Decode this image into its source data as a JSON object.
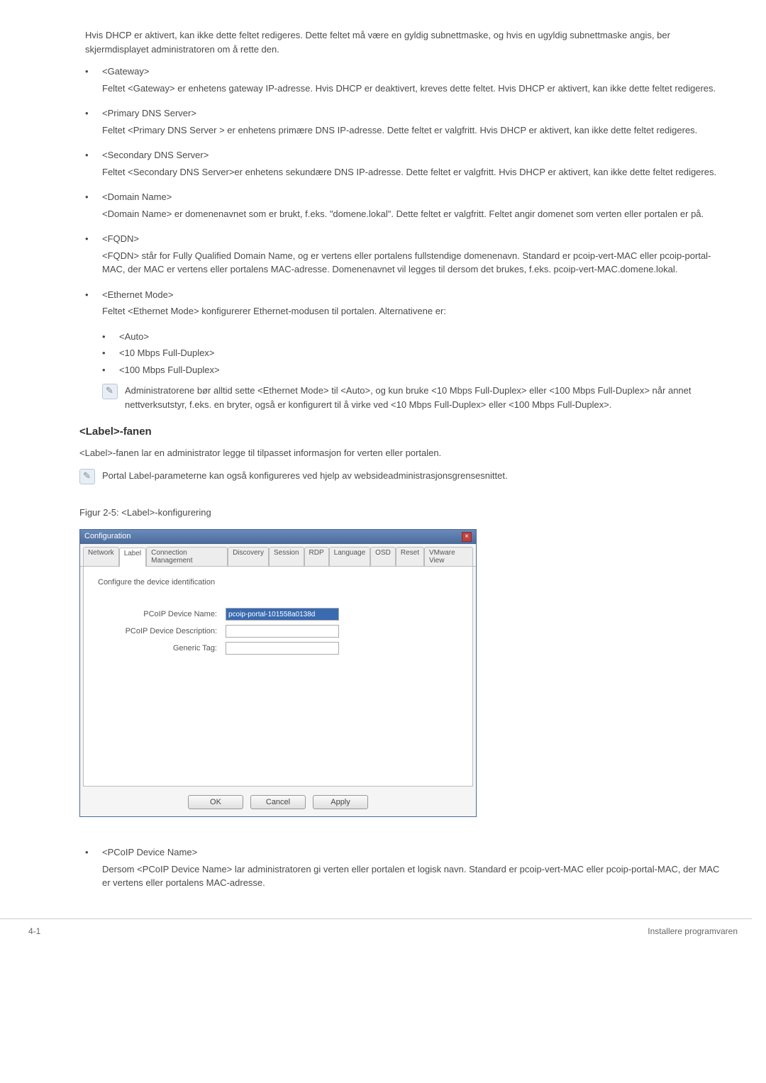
{
  "intro": {
    "p1": "Hvis DHCP er aktivert, kan ikke dette feltet redigeres. Dette feltet må være en gyldig subnettmaske, og hvis en ugyldig subnettmaske angis, ber skjermdisplayet administratoren om å rette den."
  },
  "bullets": [
    {
      "title": "<Gateway>",
      "desc": "Feltet <Gateway> er enhetens gateway IP-adresse. Hvis DHCP er deaktivert, kreves dette feltet. Hvis DHCP er aktivert, kan ikke dette feltet redigeres."
    },
    {
      "title": "<Primary DNS Server>",
      "desc": "Feltet <Primary DNS Server > er enhetens primære DNS IP-adresse. Dette feltet er valgfritt. Hvis DHCP er aktivert, kan ikke dette feltet redigeres."
    },
    {
      "title": "<Secondary DNS Server>",
      "desc": "Feltet <Secondary DNS Server>er enhetens sekundære DNS IP-adresse. Dette feltet er valgfritt. Hvis DHCP er aktivert, kan ikke dette feltet redigeres."
    },
    {
      "title": "<Domain Name>",
      "desc": "<Domain Name> er domenenavnet som er brukt, f.eks. \"domene.lokal\". Dette feltet er valgfritt. Feltet angir domenet som verten eller portalen er på."
    },
    {
      "title": "<FQDN>",
      "desc": "<FQDN> står for Fully Qualified Domain Name, og er vertens eller portalens fullstendige domenenavn. Standard er pcoip-vert-MAC eller pcoip-portal-MAC, der MAC er vertens eller portalens MAC-adresse. Domenenavnet vil legges til dersom det brukes, f.eks. pcoip-vert-MAC.domene.lokal."
    },
    {
      "title": "<Ethernet Mode>",
      "desc": "Feltet <Ethernet Mode> konfigurerer Ethernet-modusen til portalen. Alternativene er:",
      "sub": [
        "<Auto>",
        "<10 Mbps Full-Duplex>",
        "<100 Mbps Full-Duplex>"
      ],
      "note": "Administratorene bør alltid sette <Ethernet Mode> til <Auto>, og kun bruke <10 Mbps Full-Duplex> eller <100 Mbps Full-Duplex> når annet nettverksutstyr, f.eks. en bryter, også er konfigurert til å virke ved <10 Mbps Full-Duplex> eller <100 Mbps Full-Duplex>."
    }
  ],
  "section": {
    "title": "<Label>-fanen",
    "intro": "<Label>-fanen lar en administrator legge til tilpasset informasjon for verten eller portalen.",
    "note": "Portal Label-parameterne kan også konfigureres ved hjelp av websideadministrasjonsgrensesnittet.",
    "caption": "Figur 2-5: <Label>-konfigurering"
  },
  "dialog": {
    "title": "Configuration",
    "tabs": [
      "Network",
      "Label",
      "Connection Management",
      "Discovery",
      "Session",
      "RDP",
      "Language",
      "OSD",
      "Reset",
      "VMware View"
    ],
    "active_tab_index": 1,
    "heading": "Configure the device identification",
    "fields": [
      {
        "label": "PCoIP Device Name:",
        "value": "pcoip-portal-101558a0138d",
        "selected": true
      },
      {
        "label": "PCoIP Device Description:",
        "value": "",
        "selected": false
      },
      {
        "label": "Generic Tag:",
        "value": "",
        "selected": false
      }
    ],
    "buttons": {
      "ok": "OK",
      "cancel": "Cancel",
      "apply": "Apply"
    }
  },
  "bottom_bullet": {
    "title": "<PCoIP Device Name>",
    "desc": "Dersom <PCoIP Device Name> lar administratoren gi verten eller portalen et logisk navn. Standard er pcoip-vert-MAC eller pcoip-portal-MAC, der MAC er vertens eller portalens MAC-adresse."
  },
  "footer": {
    "left": "4-1",
    "right": "Installere programvaren"
  }
}
